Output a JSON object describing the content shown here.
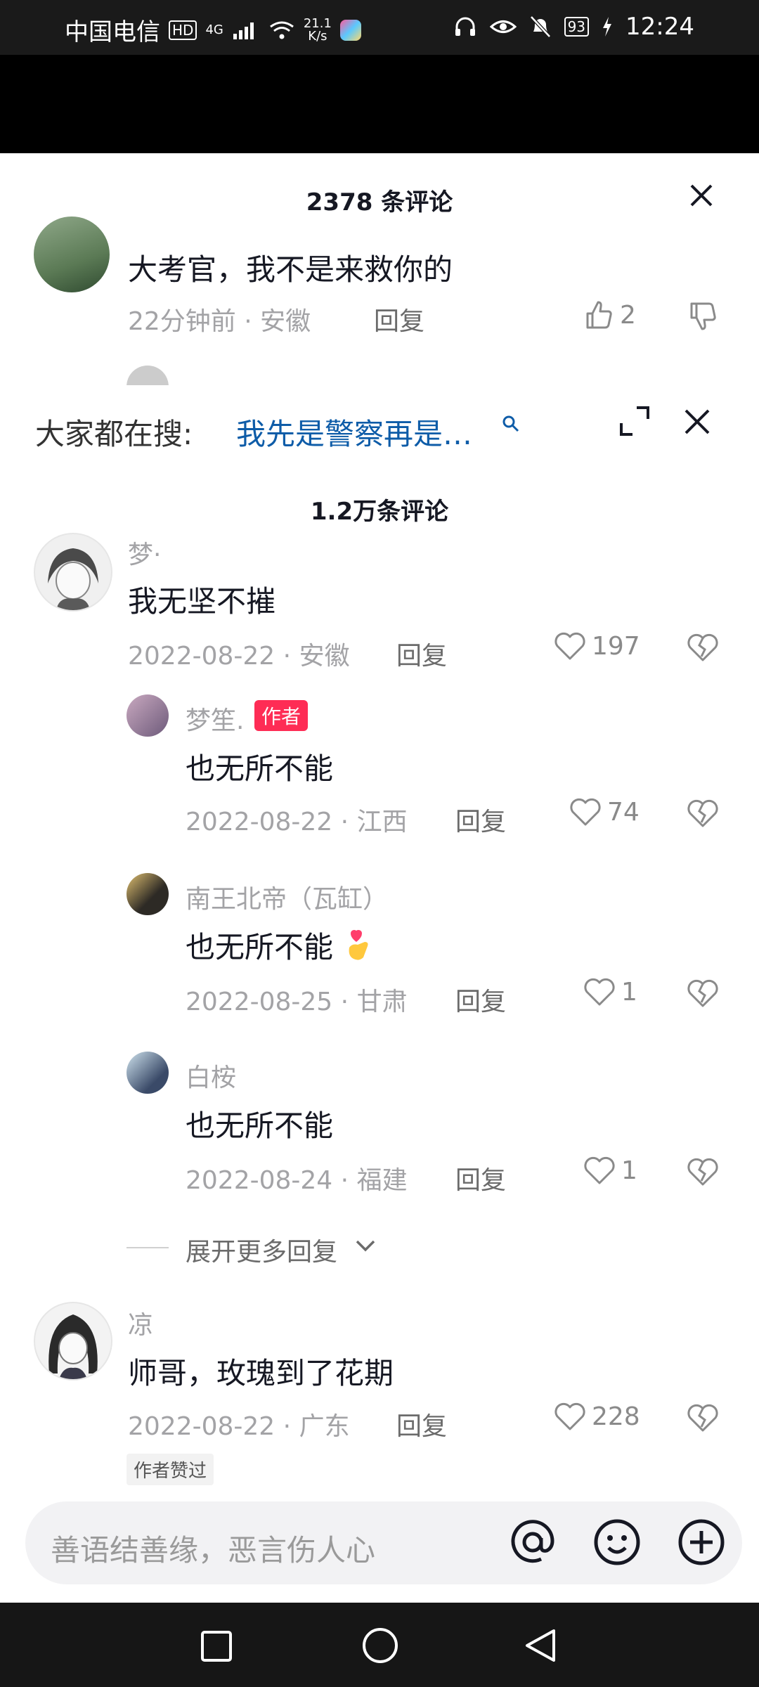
{
  "status_bar": {
    "carrier": "中国电信",
    "hd": "HD",
    "net_top": "4G",
    "speed_value": "21.1",
    "speed_unit": "K/s",
    "battery": "93",
    "time": "12:24"
  },
  "sheet_behind": {
    "ghost_text": "",
    "title": "2378 条评论",
    "comment": {
      "text": "大考官，我不是来救你的",
      "time": "22分钟前",
      "location": "安徽",
      "reply_label": "回复",
      "likes": "2"
    }
  },
  "search_bar": {
    "label": "大家都在搜:",
    "query": "我先是警察再是…"
  },
  "comments_title": "1.2万条评论",
  "comments": [
    {
      "name": "梦·",
      "text": "我无坚不摧",
      "date": "2022-08-22",
      "location": "安徽",
      "reply_label": "回复",
      "likes": "197",
      "replies": [
        {
          "name": "梦笙.",
          "badge": "作者",
          "text": "也无所不能",
          "date": "2022-08-22",
          "location": "江西",
          "reply_label": "回复",
          "likes": "74"
        },
        {
          "name": "南王北帝（瓦缸）",
          "text": "也无所不能",
          "date": "2022-08-25",
          "location": "甘肃",
          "reply_label": "回复",
          "likes": "1"
        },
        {
          "name": "白桉",
          "text": "也无所不能",
          "date": "2022-08-24",
          "location": "福建",
          "reply_label": "回复",
          "likes": "1"
        }
      ],
      "expand_label": "展开更多回复"
    },
    {
      "name": "凉",
      "text": "师哥，玫瑰到了花期",
      "date": "2022-08-22",
      "location": "广东",
      "reply_label": "回复",
      "likes": "228",
      "praised_label": "作者赞过"
    }
  ],
  "input": {
    "placeholder": "善语结善缘，恶言伤人心"
  },
  "colors": {
    "accent_red": "#fe2c55",
    "search_link": "#0e5ca8"
  }
}
